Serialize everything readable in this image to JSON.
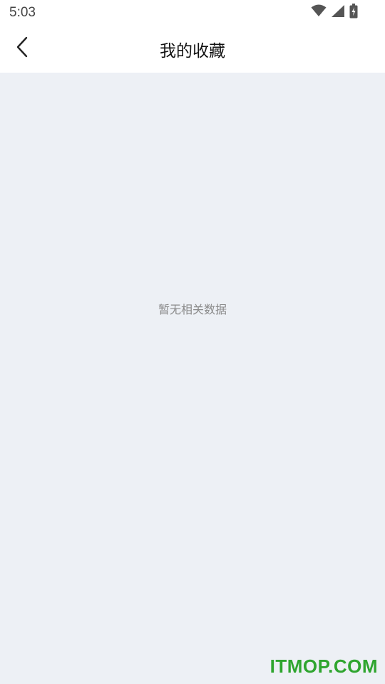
{
  "status_bar": {
    "time": "5:03",
    "icons": [
      "wifi-icon",
      "cellular-signal-icon",
      "battery-charging-icon"
    ]
  },
  "nav": {
    "back_icon": "chevron-left-icon",
    "title": "我的收藏"
  },
  "content": {
    "empty_message": "暂无相关数据"
  },
  "watermark": {
    "text": "ITMOP.COM",
    "color": "#2fa52f"
  },
  "colors": {
    "content_background": "#edf0f5",
    "header_background": "#ffffff"
  }
}
